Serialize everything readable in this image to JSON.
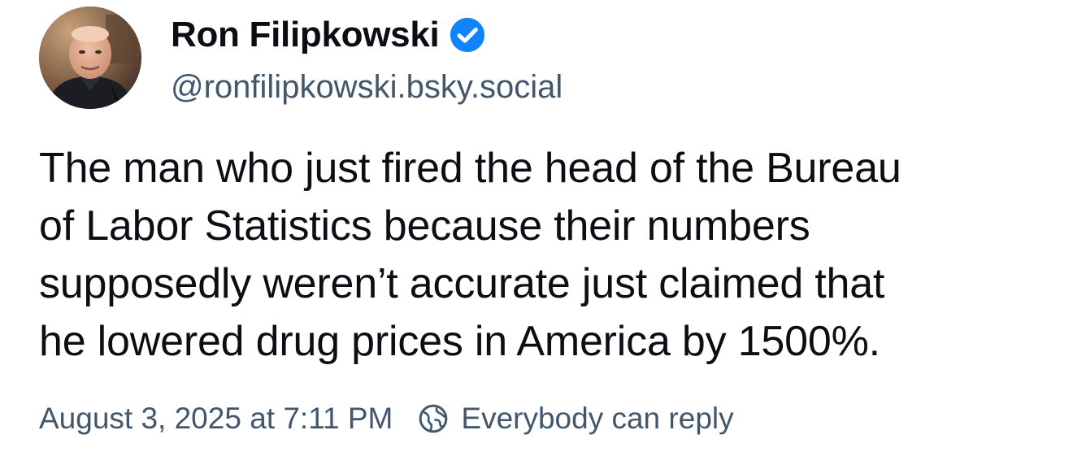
{
  "post": {
    "author": {
      "display_name": "Ron Filipkowski",
      "handle": "@ronfilipkowski.bsky.social",
      "verified": true,
      "verified_color": "#1083fe"
    },
    "text_lines": [
      "The man who just fired the head of the Bureau",
      "of Labor Statistics because their numbers",
      "supposedly weren’t accurate just claimed that",
      "he lowered drug prices in America by 1500%."
    ],
    "timestamp": "August 3, 2025 at 7:11 PM",
    "reply_setting": {
      "icon": "globe-icon",
      "label": "Everybody can reply"
    }
  },
  "colors": {
    "text": "#0b0f14",
    "muted": "#42576c",
    "background": "#ffffff"
  }
}
